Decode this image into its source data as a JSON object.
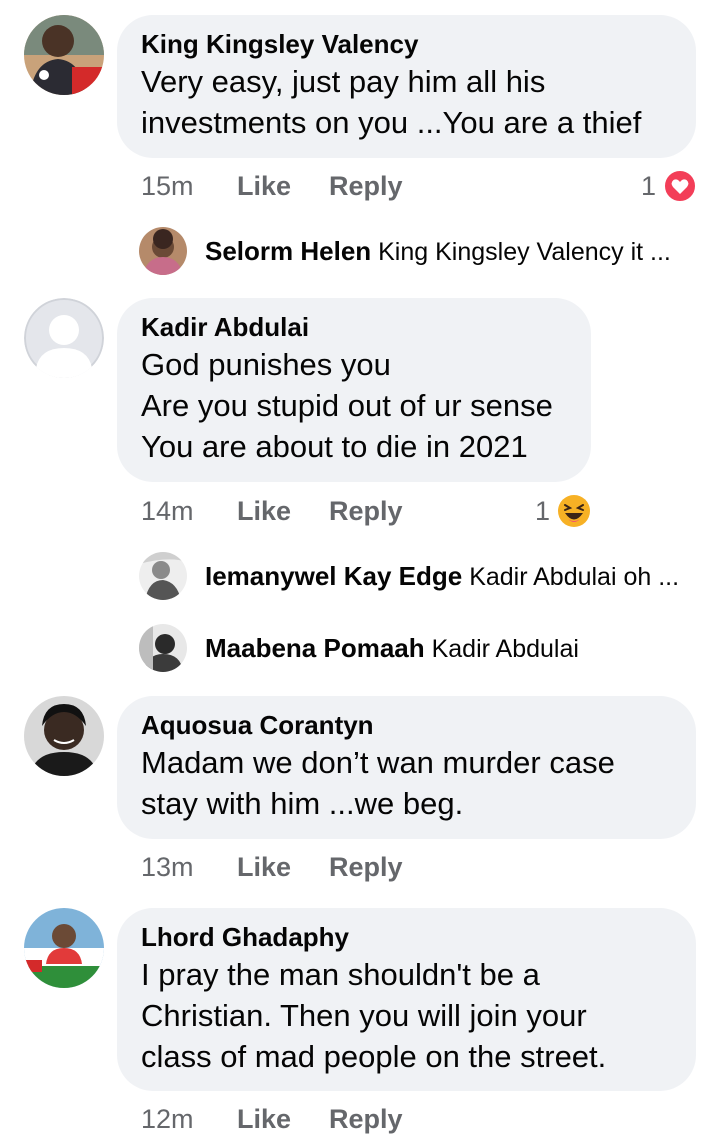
{
  "comments": [
    {
      "author": "King Kingsley Valency",
      "lines": [
        "Very easy, just pay him all his",
        "investments on you ...You are a thief"
      ],
      "time": "15m",
      "like": "Like",
      "reply": "Reply",
      "reaction_count": "1",
      "reaction_icon": "love-reaction-icon",
      "replies": [
        {
          "author": "Selorm Helen",
          "snippet": "King Kingsley Valency it ..."
        }
      ]
    },
    {
      "author": "Kadir Abdulai",
      "lines": [
        "God punishes you",
        "Are you stupid out of ur sense",
        "You are about to die in 2021"
      ],
      "time": "14m",
      "like": "Like",
      "reply": "Reply",
      "reaction_count": "1",
      "reaction_icon": "haha-reaction-icon",
      "replies": [
        {
          "author": "Iemanywel Kay Edge",
          "snippet": "Kadir Abdulai oh ..."
        },
        {
          "author": "Maabena Pomaah",
          "snippet": "Kadir Abdulai"
        }
      ]
    },
    {
      "author": "Aquosua Corantyn",
      "lines": [
        "Madam we don’t wan murder case",
        "stay with him ...we beg."
      ],
      "time": "13m",
      "like": "Like",
      "reply": "Reply"
    },
    {
      "author": "Lhord Ghadaphy",
      "lines": [
        "I pray the man shouldn't be a",
        "Christian. Then you will join your",
        "class of mad people on the street."
      ],
      "time": "12m",
      "like": "Like",
      "reply": "Reply"
    }
  ],
  "colors": {
    "bubble": "#f0f2f5",
    "meta_text": "#65676b",
    "love": "#f33e58",
    "haha": "#f7b125"
  }
}
